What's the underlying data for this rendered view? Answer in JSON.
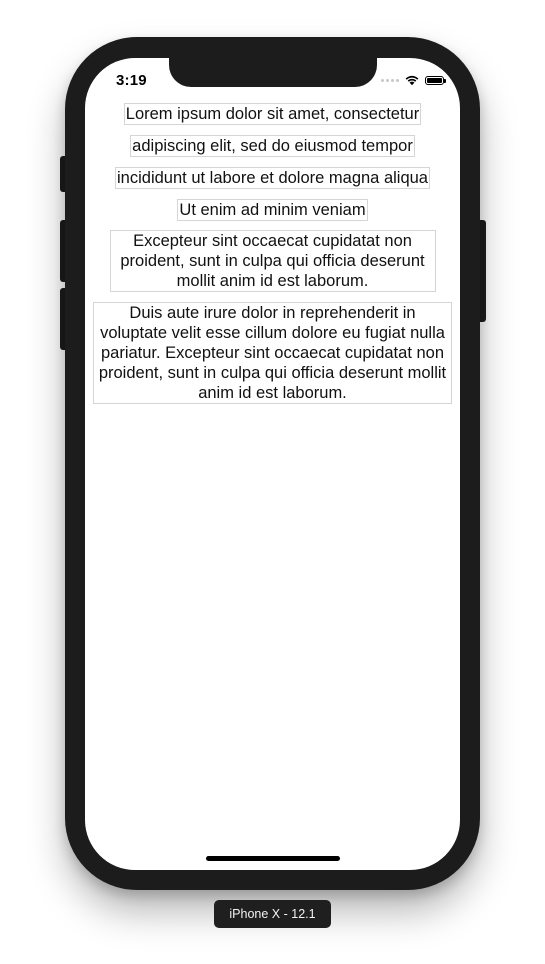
{
  "status_bar": {
    "time": "3:19"
  },
  "content": {
    "lines": [
      "Lorem ipsum dolor sit amet, consectetur",
      "adipiscing elit, sed do eiusmod tempor",
      "incididunt ut labore et dolore magna aliqua",
      "Ut enim ad minim veniam"
    ],
    "paragraph_1": "Excepteur sint occaecat cupidatat non proident, sunt in culpa qui officia deserunt mollit anim id est laborum.",
    "paragraph_2": "Duis aute irure dolor in reprehenderit in voluptate velit esse cillum dolore eu fugiat nulla pariatur. Excepteur sint occaecat cupidatat non proident, sunt in culpa qui officia deserunt mollit anim id est laborum."
  },
  "simulator": {
    "device_label": "iPhone X - 12.1"
  },
  "icons": {
    "cellular": "cellular-signal-icon",
    "wifi": "wifi-icon",
    "battery": "battery-icon"
  },
  "colors": {
    "device_frame": "#1c1c1c",
    "screen_background": "#ffffff",
    "label_border": "#d5d5d5",
    "text": "#111111"
  }
}
